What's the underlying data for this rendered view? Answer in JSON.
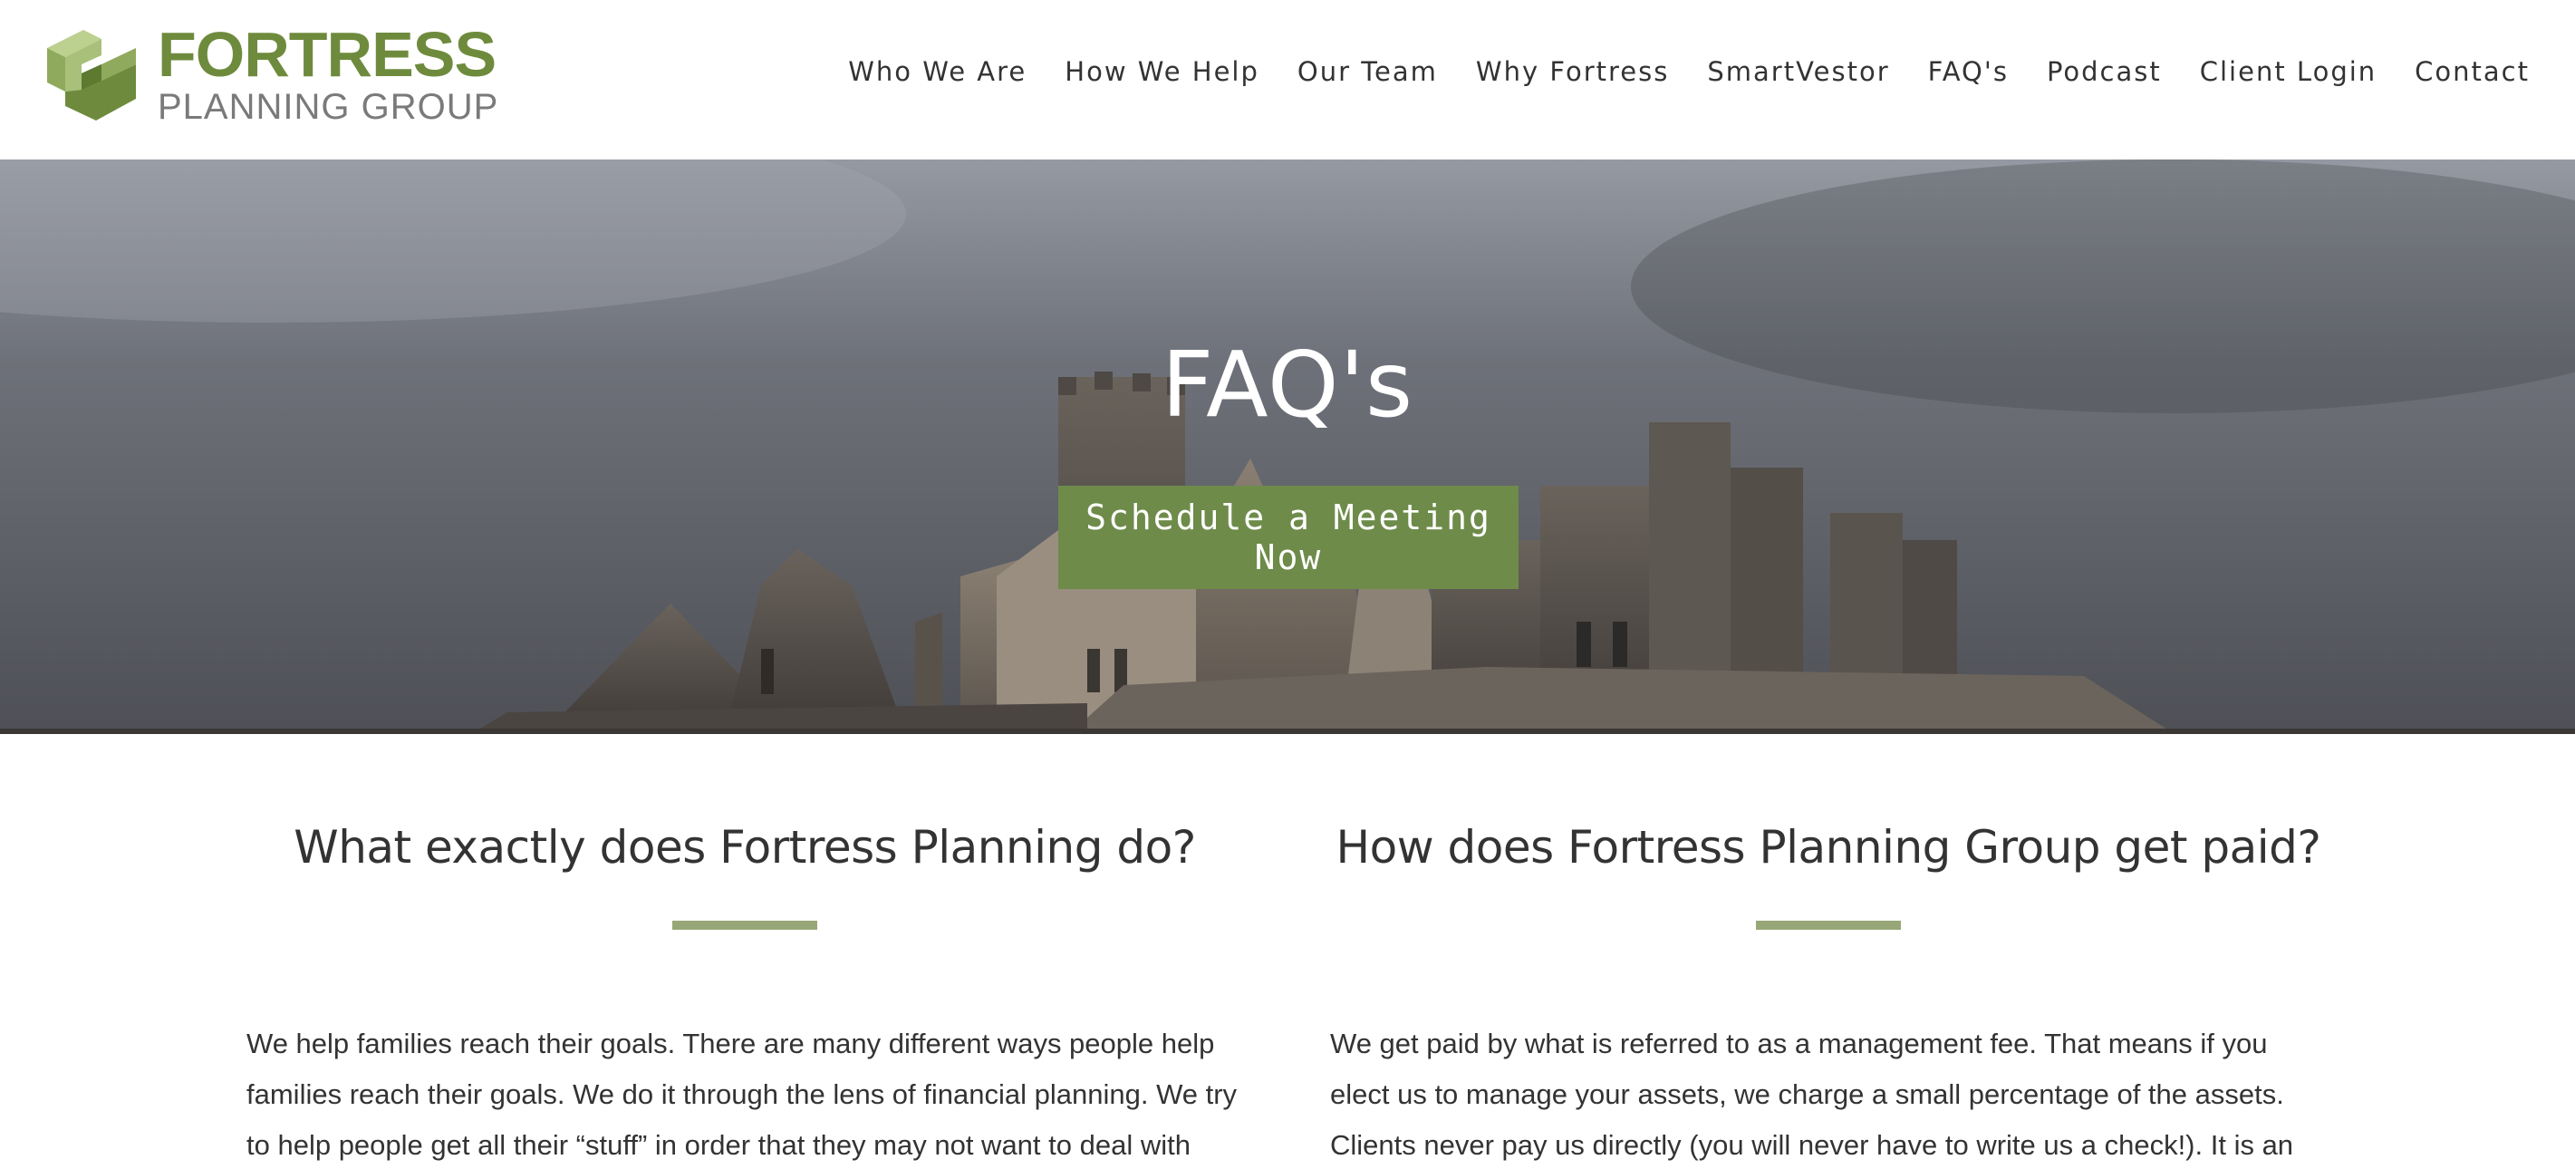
{
  "header": {
    "logo": {
      "title": "FORTRESS",
      "subtitle": "PLANNING GROUP",
      "icon": "fortress-logo-icon",
      "colors": {
        "brand_green": "#6e8b3d",
        "light_green": "#a8c07a",
        "gray": "#7a7a7a"
      }
    },
    "nav": [
      {
        "label": "Who We Are"
      },
      {
        "label": "How We Help"
      },
      {
        "label": "Our Team"
      },
      {
        "label": "Why Fortress"
      },
      {
        "label": "SmartVestor"
      },
      {
        "label": "FAQ's"
      },
      {
        "label": "Podcast"
      },
      {
        "label": "Client Login"
      },
      {
        "label": "Contact"
      }
    ]
  },
  "hero": {
    "title": "FAQ's",
    "button_label": "Schedule a Meeting Now",
    "button_color": "#6e8b4a",
    "background": "castle-ruins-stormy-sky-image"
  },
  "faqs": [
    {
      "question": "What exactly does Fortress Planning do?",
      "answer": "We help families reach their goals. There are many different ways people help families reach their goals. We do it through the lens of financial planning. We try to help people get all their “stuff” in order that they may not want to deal with"
    },
    {
      "question": "How does Fortress Planning Group get paid?",
      "answer": "We get paid by what is referred to as a management fee. That means if you elect us to manage your assets, we charge a small percentage of the assets. Clients never pay us directly (you will never have to write us a check!). It is an automatic fee that"
    }
  ],
  "accent_bar_color": "#97a777"
}
